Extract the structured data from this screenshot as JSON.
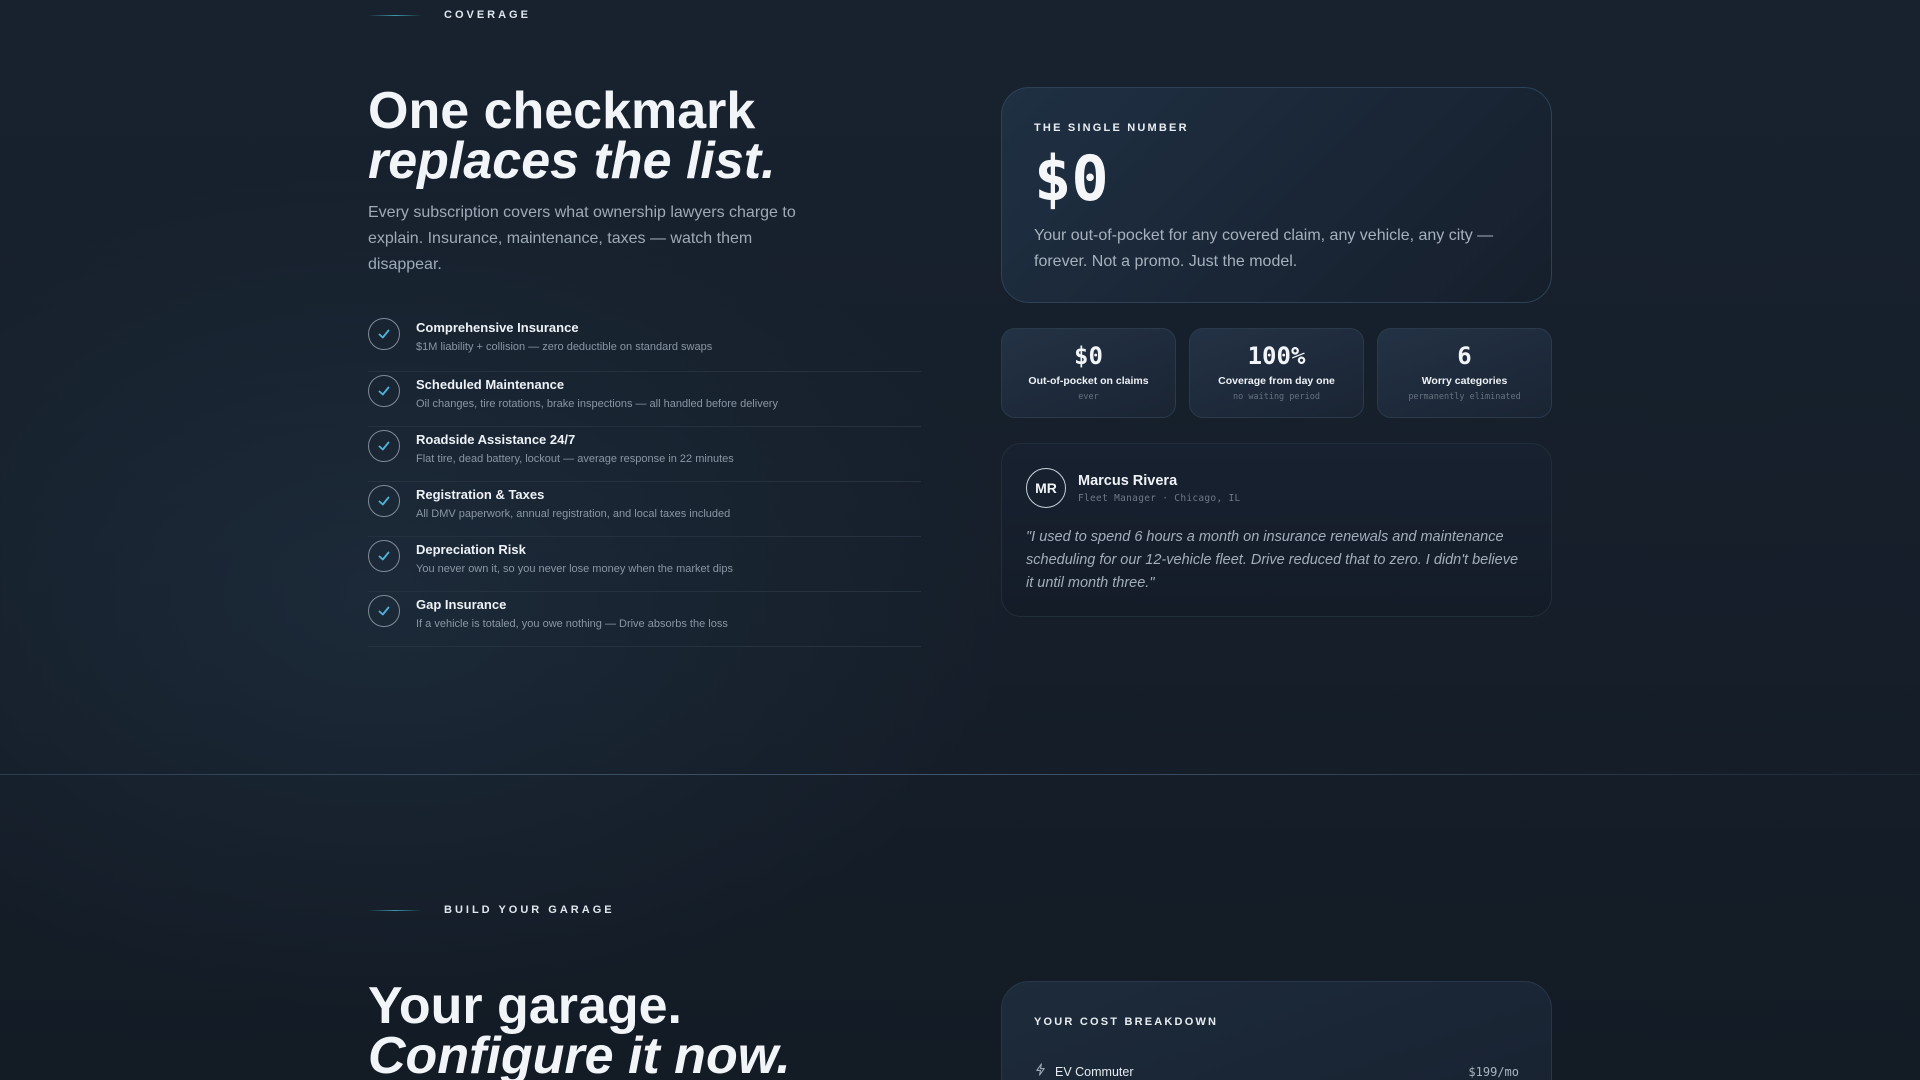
{
  "coverage": {
    "section_label": "COVERAGE",
    "headline_line1": "One checkmark",
    "headline_line2": "replaces the list.",
    "lede": "Every subscription covers what ownership lawyers charge to explain. Insurance, maintenance, taxes — watch them disappear.",
    "items": [
      {
        "title": "Comprehensive Insurance",
        "desc": "$1M liability + collision — zero deductible on standard swaps"
      },
      {
        "title": "Scheduled Maintenance",
        "desc": "Oil changes, tire rotations, brake inspections — all handled before delivery"
      },
      {
        "title": "Roadside Assistance 24/7",
        "desc": "Flat tire, dead battery, lockout — average response in 22 minutes"
      },
      {
        "title": "Registration & Taxes",
        "desc": "All DMV paperwork, annual registration, and local taxes included"
      },
      {
        "title": "Depreciation Risk",
        "desc": "You never own it, so you never lose money when the market dips"
      },
      {
        "title": "Gap Insurance",
        "desc": "If a vehicle is totaled, you owe nothing — Drive absorbs the loss"
      }
    ],
    "hero": {
      "eyebrow": "THE SINGLE NUMBER",
      "number": "$0",
      "desc": "Your out-of-pocket for any covered claim, any vehicle, any city — forever. Not a promo. Just the model."
    },
    "stats": [
      {
        "value": "$0",
        "label": "Out-of-pocket on claims",
        "sub": "ever"
      },
      {
        "value": "100%",
        "label": "Coverage from day one",
        "sub": "no waiting period"
      },
      {
        "value": "6",
        "label": "Worry categories",
        "sub": "permanently eliminated"
      }
    ],
    "testimonial": {
      "initials": "MR",
      "name": "Marcus Rivera",
      "role": "Fleet Manager · Chicago, IL",
      "quote": "\"I used to spend 6 hours a month on insurance renewals and maintenance scheduling for our 12-vehicle fleet. Drive reduced that to zero. I didn't believe it until month three.\""
    }
  },
  "garage": {
    "section_label": "BUILD YOUR GARAGE",
    "headline_line1": "Your garage.",
    "headline_line2": "Configure it now.",
    "cost_card": {
      "eyebrow": "YOUR COST BREAKDOWN",
      "rows": [
        {
          "icon": "bolt-icon",
          "name": "EV Commuter",
          "price": "$199/mo"
        }
      ]
    }
  },
  "colors": {
    "accent": "#4fb3d9",
    "background": "#141c27"
  }
}
